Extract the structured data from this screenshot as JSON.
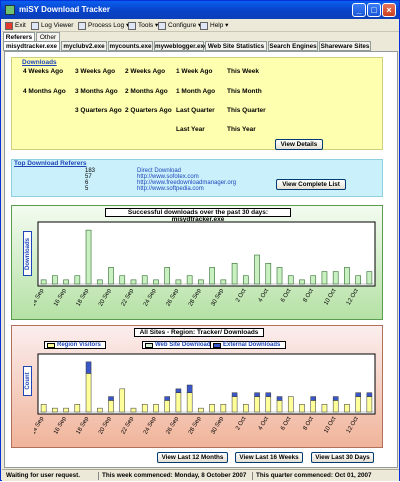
{
  "window": {
    "title": "miSY Download Tracker"
  },
  "menu": [
    "Exit",
    "Log Viewer",
    "Process Log",
    "Tools",
    "Configure",
    "Help"
  ],
  "top_tabs": [
    "Referers",
    "Other"
  ],
  "file_tabs": [
    "misydtracker.exe",
    "myclubv2.exe",
    "mycounts.exe",
    "myweblogger.exe",
    "Web Site Statistics",
    "Search Engines",
    "Shareware Sites"
  ],
  "downloads": {
    "title": "Downloads",
    "cells": [
      "4 Weeks Ago",
      "3 Weeks Ago",
      "2 Weeks Ago",
      "1 Week Ago",
      "This Week",
      "4 Months Ago",
      "3 Months Ago",
      "2 Months Ago",
      "1 Month Ago",
      "This Month",
      "3 Quarters Ago",
      "2 Quarters Ago",
      "Last Quarter",
      "This Quarter",
      "Last Year",
      "This Year"
    ],
    "button": "View Details"
  },
  "referers": {
    "title": "Top Download Referers",
    "rows": [
      {
        "count": "183",
        "url": "Direct Download"
      },
      {
        "count": "57",
        "url": "http://www.sofotex.com"
      },
      {
        "count": "6",
        "url": "http://www.freedownloadmanager.org"
      },
      {
        "count": "5",
        "url": "http://www.softpedia.com"
      }
    ],
    "button": "View Complete List"
  },
  "chart_data": [
    {
      "type": "bar",
      "title": "Successful downloads over the past 30 days: misydtracker.exe",
      "ylabel": "Downloads",
      "colors": {
        "bar": "#c8f0c0",
        "stroke": "#2f6a2f"
      },
      "categories": [
        "14 Sep",
        "15 Sep",
        "16 Sep",
        "17 Sep",
        "18 Sep",
        "19 Sep",
        "20 Sep",
        "21 Sep",
        "22 Sep",
        "23 Sep",
        "24 Sep",
        "25 Sep",
        "26 Sep",
        "27 Sep",
        "28 Sep",
        "29 Sep",
        "30 Sep",
        "1 Oct",
        "2 Oct",
        "3 Oct",
        "4 Oct",
        "5 Oct",
        "6 Oct",
        "7 Oct",
        "8 Oct",
        "9 Oct",
        "10 Oct",
        "11 Oct",
        "12 Oct",
        "13 Oct"
      ],
      "tick_labels": [
        "14 Sep",
        "16 Sep",
        "18 Sep",
        "20 Sep",
        "22 Sep",
        "24 Sep",
        "26 Sep",
        "28 Sep",
        "30 Sep",
        "2 Oct",
        "4 Oct",
        "6 Oct",
        "8 Oct",
        "10 Oct",
        "12 Oct"
      ],
      "values": [
        1,
        2,
        1,
        2,
        13,
        1,
        4,
        2,
        1,
        2,
        1,
        4,
        1,
        2,
        1,
        4,
        1,
        5,
        2,
        7,
        5,
        4,
        2,
        1,
        2,
        3,
        3,
        4,
        2,
        3
      ],
      "ylim": [
        0,
        14
      ]
    },
    {
      "type": "bar",
      "title": "All Sites - Region: Tracker/ Downloads",
      "ylabel": "Count",
      "legend": [
        "Region Visitors",
        "Web Site Downloads",
        "External Downloads"
      ],
      "colors": {
        "visitors": "#ffff99",
        "web": "#d7efd2",
        "external": "#3a57c7",
        "stroke": "#333333"
      },
      "categories": [
        "14 Sep",
        "15 Sep",
        "16 Sep",
        "17 Sep",
        "18 Sep",
        "19 Sep",
        "20 Sep",
        "21 Sep",
        "22 Sep",
        "23 Sep",
        "24 Sep",
        "25 Sep",
        "26 Sep",
        "27 Sep",
        "28 Sep",
        "29 Sep",
        "30 Sep",
        "1 Oct",
        "2 Oct",
        "3 Oct",
        "4 Oct",
        "5 Oct",
        "6 Oct",
        "7 Oct",
        "8 Oct",
        "9 Oct",
        "10 Oct",
        "11 Oct",
        "12 Oct",
        "13 Oct"
      ],
      "tick_labels": [
        "14 Sep",
        "16 Sep",
        "18 Sep",
        "20 Sep",
        "22 Sep",
        "24 Sep",
        "26 Sep",
        "28 Sep",
        "30 Sep",
        "2 Oct",
        "4 Oct",
        "6 Oct",
        "8 Oct",
        "10 Oct",
        "12 Oct"
      ],
      "series": [
        {
          "name": "Region Visitors",
          "values": [
            2,
            1,
            1,
            2,
            10,
            1,
            3,
            6,
            1,
            2,
            2,
            3,
            5,
            5,
            1,
            2,
            2,
            4,
            2,
            4,
            4,
            3,
            4,
            2,
            3,
            2,
            3,
            2,
            4,
            4
          ]
        },
        {
          "name": "Web Site Downloads",
          "values": [
            0,
            0,
            0,
            0,
            0,
            0,
            0,
            0,
            0,
            0,
            0,
            0,
            0,
            0,
            0,
            0,
            0,
            0,
            0,
            0,
            0,
            0,
            0,
            0,
            0,
            0,
            0,
            0,
            0,
            0
          ]
        },
        {
          "name": "External Downloads",
          "values": [
            0,
            0,
            0,
            0,
            3,
            0,
            1,
            0,
            0,
            0,
            0,
            1,
            1,
            2,
            0,
            0,
            0,
            1,
            0,
            1,
            1,
            1,
            0,
            0,
            1,
            0,
            1,
            0,
            1,
            1
          ]
        }
      ],
      "ylim": [
        0,
        14
      ]
    }
  ],
  "bottom_buttons": [
    "View Last 12 Months",
    "View Last 16 Weeks",
    "View Last 30 Days"
  ],
  "status": [
    "Waiting for user request.",
    "This week commenced: Monday, 8 October 2007",
    "This quarter commenced: Oct 01, 2007"
  ]
}
